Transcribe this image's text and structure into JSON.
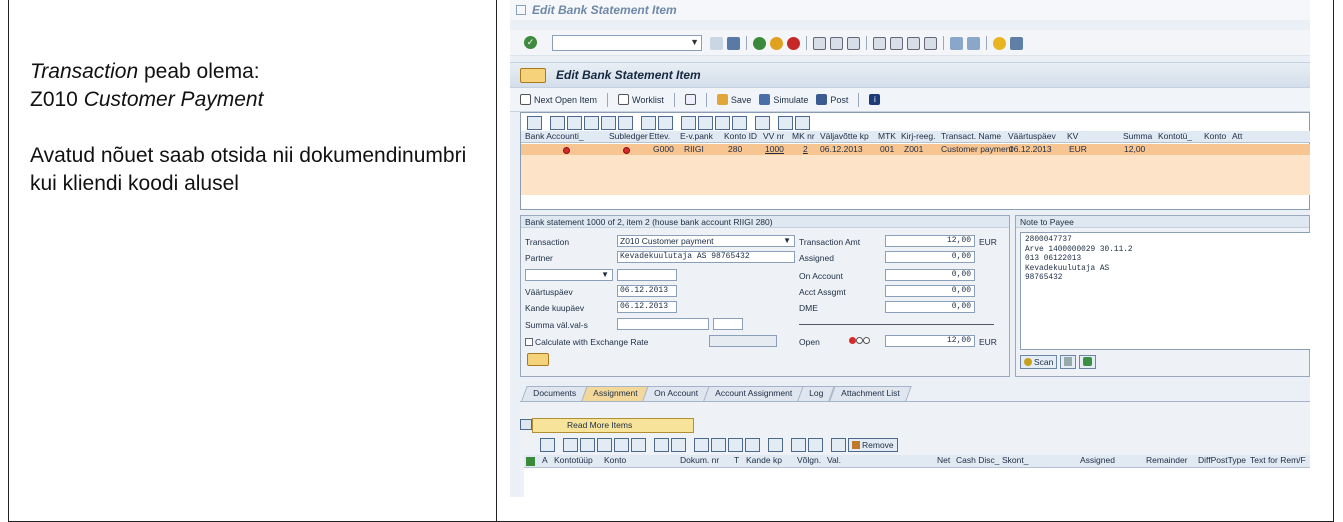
{
  "doc": {
    "line1_italic": "Transaction",
    "line1_rest": " peab olema:",
    "line2_code": "Z010 ",
    "line2_italic": "Customer Payment",
    "para2": "Avatud nõuet saab otsida nii dokumendinumbri kui kliendi koodi alusel"
  },
  "sap": {
    "window_title": "Edit Bank Statement Item",
    "app_title": "Edit Bank Statement Item",
    "toolbar": {
      "next_open_item": "Next Open Item",
      "worklist": "Worklist",
      "save": "Save",
      "simulate": "Simulate",
      "post": "Post"
    },
    "grid1": {
      "columns": [
        "Bank Accounti_",
        "Subledger",
        "Ettev.",
        "E-v.pank",
        "Konto ID",
        "VV nr",
        "MK nr",
        "Väljavõtte kp",
        "MTK",
        "Kirj-reeg.",
        "Transact. Name",
        "Väärtuspäev",
        "KV",
        "Summa",
        "Kontotü_",
        "Konto",
        "Att"
      ],
      "row": [
        "",
        "",
        "G000",
        "RIIGI",
        "280",
        "1000",
        "2",
        "06.12.2013",
        "001",
        "Z001",
        "Customer payment",
        "06.12.2013",
        "EUR",
        "12,00"
      ]
    },
    "detail": {
      "header": "Bank statement 1000 of 2, item 2 (house bank account RIIGI 280)",
      "transaction_label": "Transaction",
      "transaction_value": "Z010 Customer payment",
      "partner_label": "Partner",
      "partner_value": "Kevadekuulutaja AS 98765432",
      "vaartuspaev_label": "Väärtuspäev",
      "vaartuspaev_value": "06.12.2013",
      "kande_label": "Kande kuupäev",
      "kande_value": "06.12.2013",
      "summa_label": "Summa väl.val-s",
      "calc_label": "Calculate with Exchange Rate",
      "trans_amt_label": "Transaction Amt",
      "trans_amt_value": "12,00",
      "assigned_label": "Assigned",
      "assigned_value": "0,00",
      "on_account_label": "On Account",
      "on_account_value": "0,00",
      "acct_assgmt_label": "Acct Assgmt",
      "acct_assgmt_value": "0,00",
      "dme_label": "DME",
      "dme_value": "0,00",
      "open_label": "Open",
      "open_value": "12,00",
      "currency": "EUR"
    },
    "note": {
      "header": "Note to Payee",
      "text": "2800047737\nArve 1400000029 30.11.2\n013 06122013\nKevadekuulutaja AS\n98765432",
      "scan": "Scan"
    },
    "tabs": [
      "Documents",
      "Assignment",
      "On Account",
      "Account Assignment",
      "Log",
      "Attachment List"
    ],
    "read_more": "Read More Items",
    "remove": "Remove",
    "grid2": {
      "columns": [
        "A",
        "Kontotüüp",
        "Konto",
        "Dokum. nr",
        "T",
        "Kande kp",
        "Võlgn.",
        "Val.",
        "Net",
        "Cash Disc_",
        "Skont_",
        "Assigned",
        "Remainder",
        "DiffPostType",
        "Text for Rem/F"
      ]
    },
    "colors": {
      "selected_row": "#f7c592",
      "active_tab": "#f3d89a",
      "title_bar": "#d4deea"
    }
  }
}
